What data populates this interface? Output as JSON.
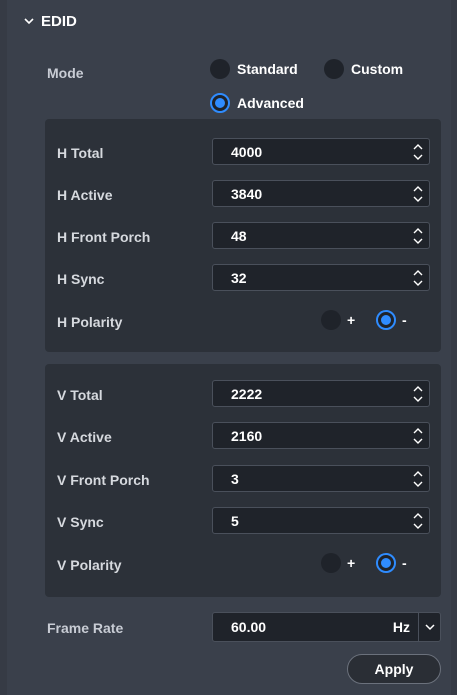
{
  "header": {
    "title": "EDID"
  },
  "mode": {
    "label": "Mode",
    "options": [
      "Standard",
      "Custom",
      "Advanced"
    ],
    "selected": "Advanced"
  },
  "horizontal": {
    "total": {
      "label": "H Total",
      "value": "4000"
    },
    "active": {
      "label": "H Active",
      "value": "3840"
    },
    "front_porch": {
      "label": "H Front Porch",
      "value": "48"
    },
    "sync": {
      "label": "H Sync",
      "value": "32"
    },
    "polarity": {
      "label": "H Polarity",
      "plus": "+",
      "minus": "-",
      "selected": "-"
    }
  },
  "vertical": {
    "total": {
      "label": "V Total",
      "value": "2222"
    },
    "active": {
      "label": "V Active",
      "value": "2160"
    },
    "front_porch": {
      "label": "V Front Porch",
      "value": "3"
    },
    "sync": {
      "label": "V Sync",
      "value": "5"
    },
    "polarity": {
      "label": "V Polarity",
      "plus": "+",
      "minus": "-",
      "selected": "-"
    }
  },
  "frame_rate": {
    "label": "Frame Rate",
    "value": "60.00",
    "unit": "Hz"
  },
  "apply_label": "Apply",
  "colors": {
    "accent": "#2f8cff",
    "panel": "#3a404b",
    "group": "#2c3139",
    "input": "#1f232a"
  }
}
